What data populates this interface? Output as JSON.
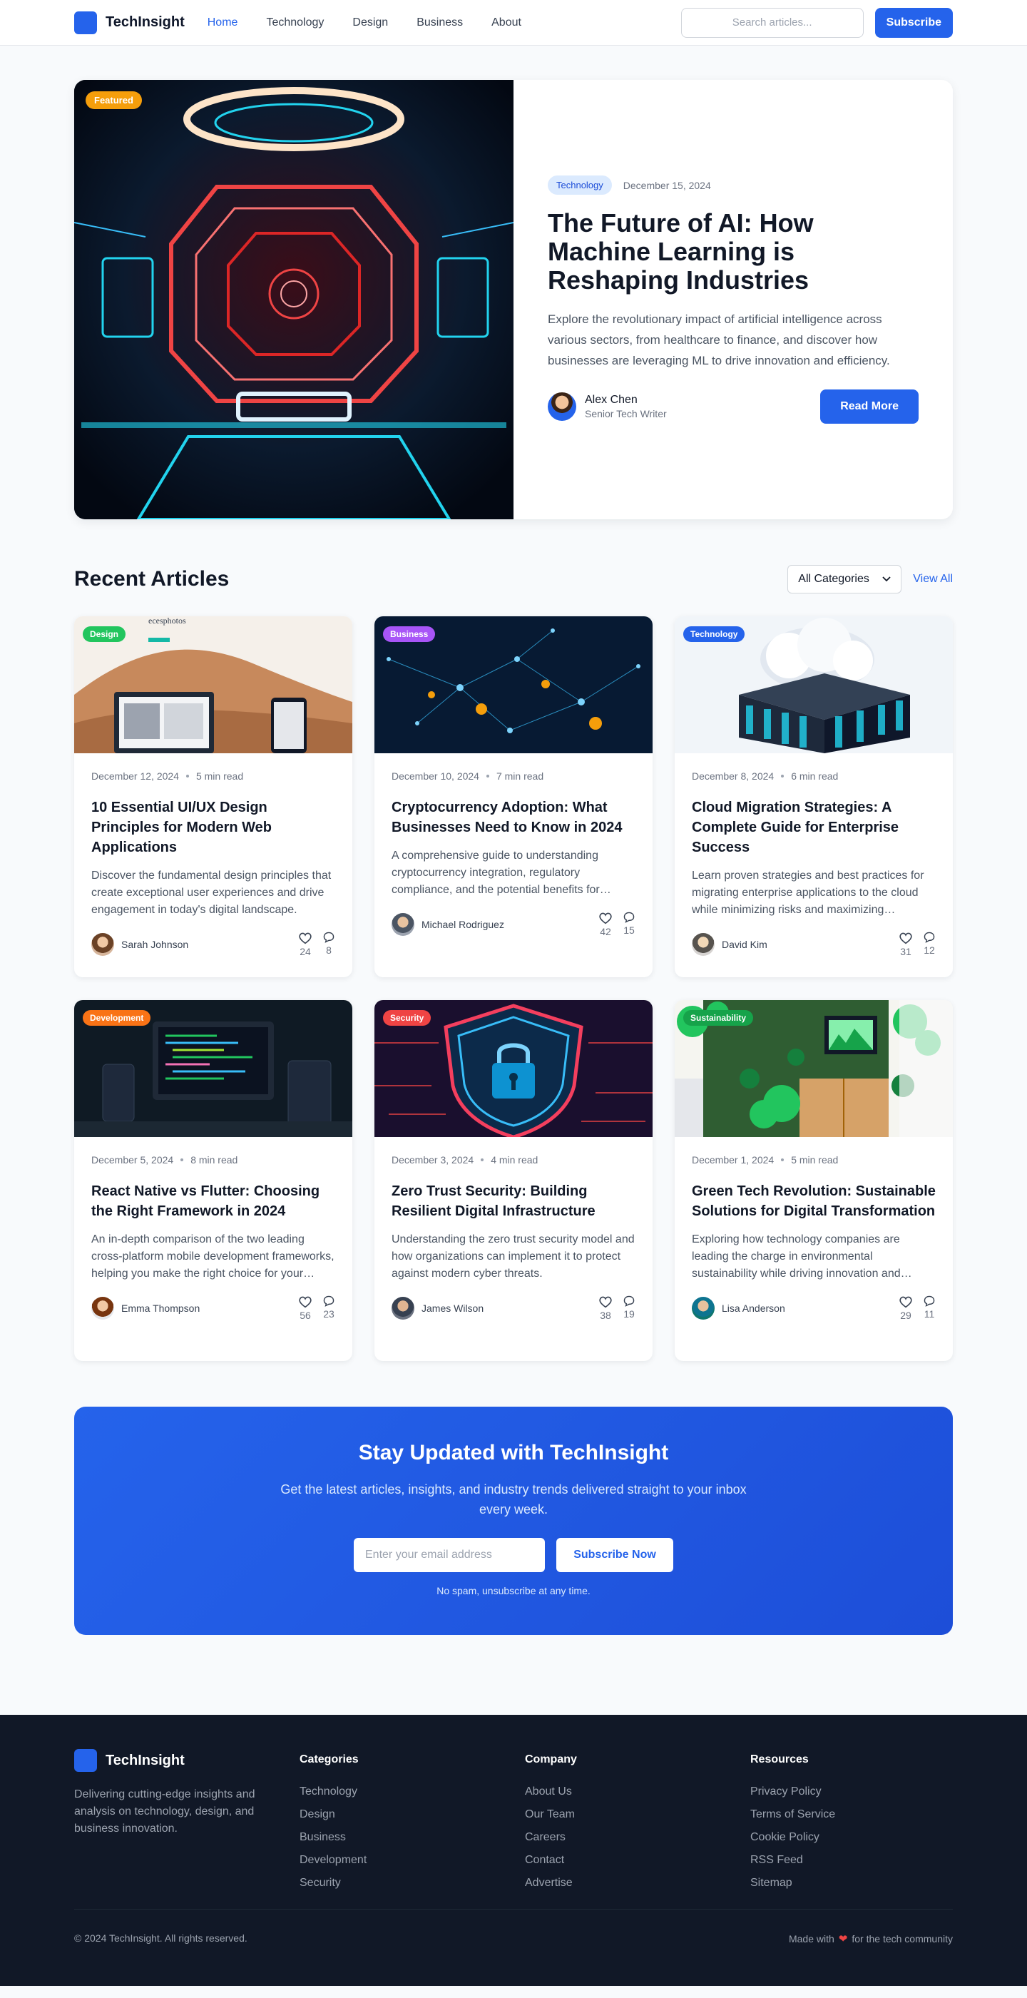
{
  "brand": {
    "name": "TechInsight",
    "accent": "#2563eb"
  },
  "nav": {
    "links": [
      {
        "label": "Home"
      },
      {
        "label": "Technology"
      },
      {
        "label": "Design"
      },
      {
        "label": "Business"
      },
      {
        "label": "About"
      }
    ],
    "search_placeholder": "Search articles...",
    "subscribe_label": "Subscribe"
  },
  "hero": {
    "badge": "Featured",
    "category": "Technology",
    "date": "December 15, 2024",
    "title": "The Future of AI: How Machine Learning is Reshaping Industries",
    "description": "Explore the revolutionary impact of artificial intelligence across various sectors, from healthcare to finance, and discover how businesses are leveraging ML to drive innovation and efficiency.",
    "author_name": "Alex Chen",
    "author_role": "Senior Tech Writer",
    "read_more": "Read More"
  },
  "recent": {
    "title": "Recent Articles",
    "filter_value": "All Categories",
    "view_all": "View All",
    "articles": [
      {
        "category": "Design",
        "badge_color": "#22c55e",
        "date": "December 12, 2024",
        "read_time": "5 min read",
        "title": "10 Essential UI/UX Design Principles for Modern Web Applications",
        "excerpt": "Discover the fundamental design principles that create exceptional user experiences and drive engagement in today's digital landscape.",
        "author": "Sarah Johnson",
        "likes": "24",
        "comments": "8"
      },
      {
        "category": "Business",
        "badge_color": "#a855f7",
        "date": "December 10, 2024",
        "read_time": "7 min read",
        "title": "Cryptocurrency Adoption: What Businesses Need to Know in 2024",
        "excerpt": "A comprehensive guide to understanding cryptocurrency integration, regulatory compliance, and the potential benefits for modern businesses.",
        "author": "Michael Rodriguez",
        "likes": "42",
        "comments": "15"
      },
      {
        "category": "Technology",
        "badge_color": "#2563eb",
        "date": "December 8, 2024",
        "read_time": "6 min read",
        "title": "Cloud Migration Strategies: A Complete Guide for Enterprise Success",
        "excerpt": "Learn proven strategies and best practices for migrating enterprise applications to the cloud while minimizing risks and maximizing efficiency.",
        "author": "David Kim",
        "likes": "31",
        "comments": "12"
      },
      {
        "category": "Development",
        "badge_color": "#f97316",
        "date": "December 5, 2024",
        "read_time": "8 min read",
        "title": "React Native vs Flutter: Choosing the Right Framework in 2024",
        "excerpt": "An in-depth comparison of the two leading cross-platform mobile development frameworks, helping you make the right choice for your project.",
        "author": "Emma Thompson",
        "likes": "56",
        "comments": "23"
      },
      {
        "category": "Security",
        "badge_color": "#ef4444",
        "date": "December 3, 2024",
        "read_time": "4 min read",
        "title": "Zero Trust Security: Building Resilient Digital Infrastructure",
        "excerpt": "Understanding the zero trust security model and how organizations can implement it to protect against modern cyber threats.",
        "author": "James Wilson",
        "likes": "38",
        "comments": "19"
      },
      {
        "category": "Sustainability",
        "badge_color": "#16a34a",
        "date": "December 1, 2024",
        "read_time": "5 min read",
        "title": "Green Tech Revolution: Sustainable Solutions for Digital Transformation",
        "excerpt": "Exploring how technology companies are leading the charge in environmental sustainability while driving innovation and growth.",
        "author": "Lisa Anderson",
        "likes": "29",
        "comments": "11"
      }
    ]
  },
  "newsletter": {
    "title": "Stay Updated with TechInsight",
    "subtitle": "Get the latest articles, insights, and industry trends delivered straight to your inbox every week.",
    "email_placeholder": "Enter your email address",
    "button": "Subscribe Now",
    "note": "No spam, unsubscribe at any time."
  },
  "footer": {
    "description": "Delivering cutting-edge insights and analysis on technology, design, and business innovation.",
    "columns": [
      {
        "heading": "Categories",
        "items": [
          "Technology",
          "Design",
          "Business",
          "Development",
          "Security"
        ]
      },
      {
        "heading": "Company",
        "items": [
          "About Us",
          "Our Team",
          "Careers",
          "Contact",
          "Advertise"
        ]
      },
      {
        "heading": "Resources",
        "items": [
          "Privacy Policy",
          "Terms of Service",
          "Cookie Policy",
          "RSS Feed",
          "Sitemap"
        ]
      }
    ],
    "copyright": "© 2024 TechInsight. All rights reserved.",
    "made_with_prefix": "Made with",
    "made_with_suffix": "for the tech community"
  }
}
